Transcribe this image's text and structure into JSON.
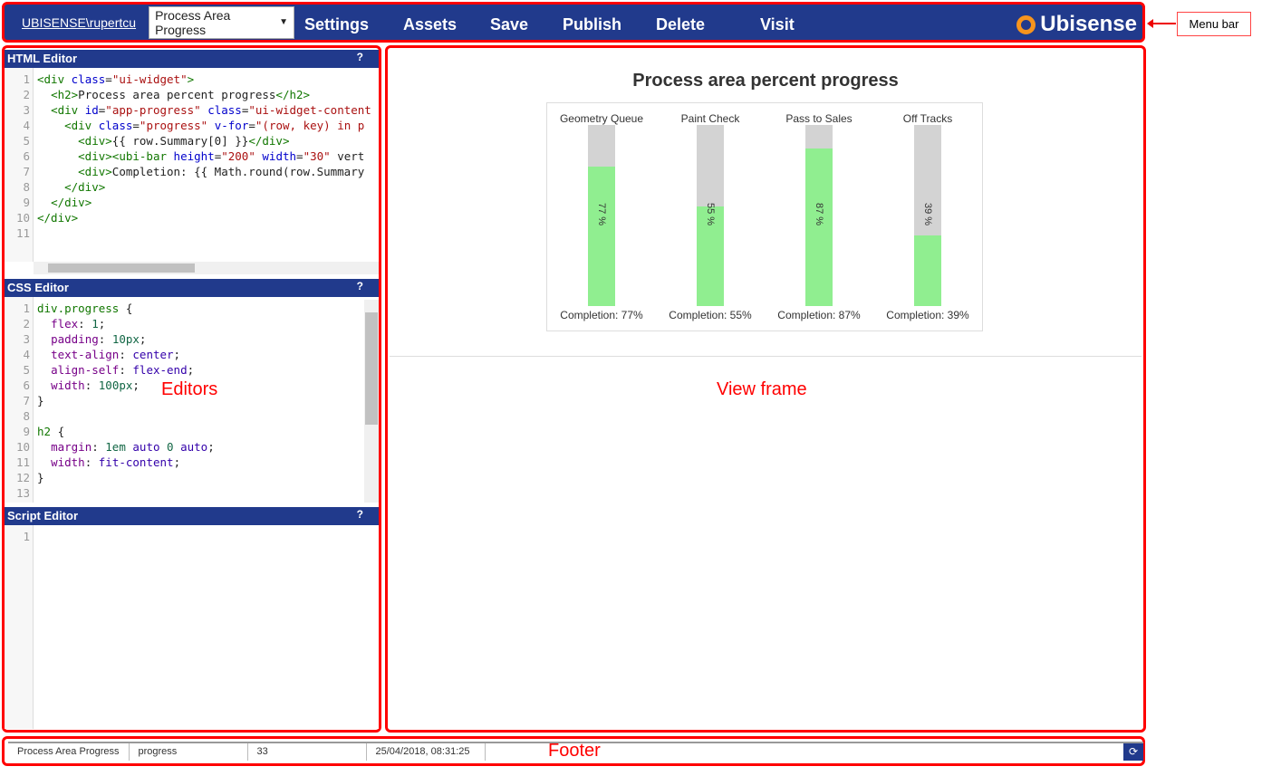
{
  "menubar": {
    "user": "UBISENSE\\rupertcu",
    "widget_select": "Process Area Progress",
    "buttons": [
      "Settings",
      "Assets",
      "Save",
      "Publish",
      "Delete",
      "Visit"
    ],
    "logo": "Ubisense"
  },
  "annotations": {
    "menu_bar": "Menu bar",
    "editors": "Editors",
    "view_frame": "View frame",
    "footer": "Footer"
  },
  "editors": {
    "html": {
      "title": "HTML Editor",
      "help": "?",
      "lines": [
        "<div class=\"ui-widget\">",
        "  <h2>Process area percent progress</h2>",
        "  <div id=\"app-progress\" class=\"ui-widget-content",
        "    <div class=\"progress\" v-for=\"(row, key) in p",
        "      <div>{{ row.Summary[0] }}</div>",
        "      <div><ubi-bar height=\"200\" width=\"30\" vert",
        "      <div>Completion: {{ Math.round(row.Summary",
        "    </div>",
        "  </div>",
        "</div>",
        ""
      ]
    },
    "css": {
      "title": "CSS Editor",
      "help": "?",
      "lines": [
        "div.progress {",
        "  flex: 1;",
        "  padding: 10px;",
        "  text-align: center;",
        "  align-self: flex-end;",
        "  width: 100px;",
        "}",
        "",
        "h2 {",
        "  margin: 1em auto 0 auto;",
        "  width: fit-content;",
        "}",
        ""
      ]
    },
    "script": {
      "title": "Script Editor",
      "help": "?",
      "lines": [
        ""
      ]
    }
  },
  "chart_data": {
    "type": "bar",
    "title": "Process area percent progress",
    "categories": [
      "Geometry Queue",
      "Paint Check",
      "Pass to Sales",
      "Off Tracks"
    ],
    "values": [
      77,
      55,
      87,
      39
    ],
    "bar_labels": [
      "77 %",
      "55 %",
      "87 %",
      "39 %"
    ],
    "completion_labels": [
      "Completion: 77%",
      "Completion: 55%",
      "Completion: 87%",
      "Completion: 39%"
    ],
    "ylim": [
      0,
      100
    ],
    "colors": {
      "fill": "#90ee90",
      "track": "#d3d3d3"
    }
  },
  "footer": {
    "cells": [
      "Process Area Progress",
      "progress",
      "33",
      "25/04/2018, 08:31:25"
    ],
    "refresh_icon": "refresh-icon"
  }
}
